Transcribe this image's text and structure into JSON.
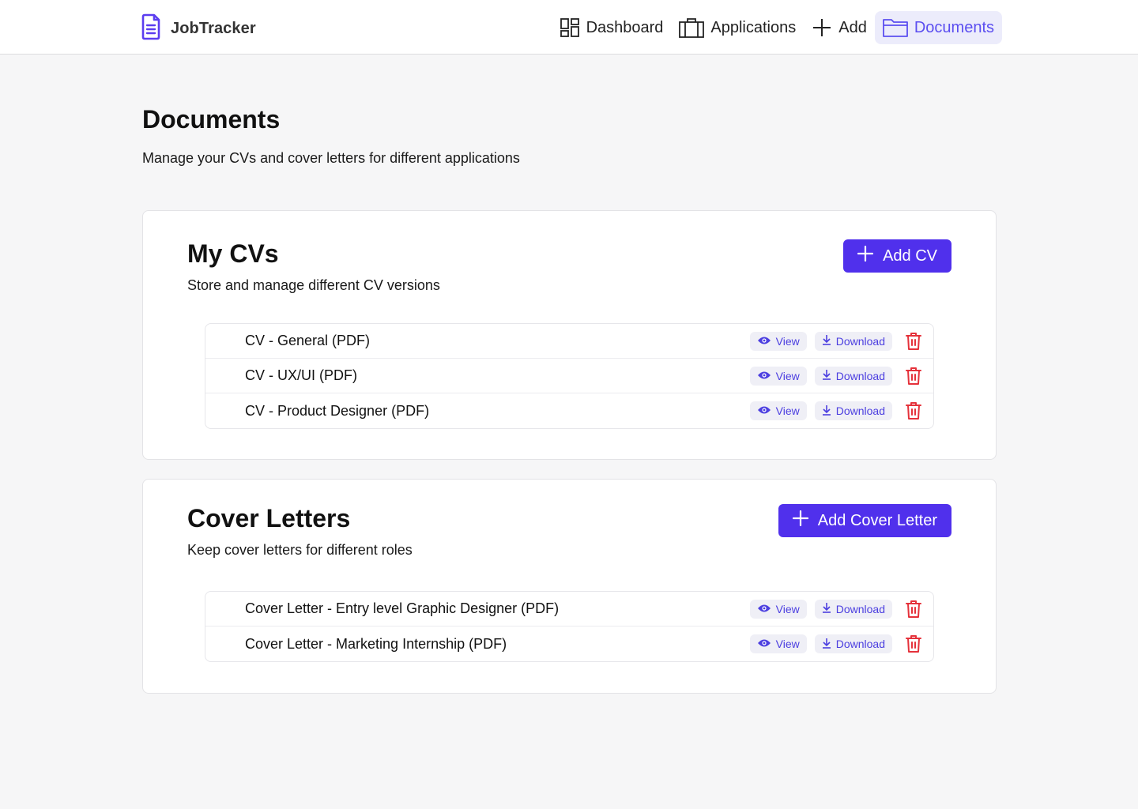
{
  "app": {
    "name": "JobTracker",
    "logo_icon": "document-icon",
    "accent": "#5030ec",
    "danger": "#e5323b"
  },
  "nav": {
    "items": [
      {
        "label": "Dashboard",
        "icon": "dashboard-icon",
        "active": false
      },
      {
        "label": "Applications",
        "icon": "briefcase-icon",
        "active": false
      },
      {
        "label": "Add",
        "icon": "plus-icon",
        "active": false
      },
      {
        "label": "Documents",
        "icon": "folder-icon",
        "active": true
      }
    ]
  },
  "page": {
    "title": "Documents",
    "subtitle": "Manage your CVs and cover letters for different applications"
  },
  "cvs": {
    "title": "My CVs",
    "subtitle": "Store and manage different CV versions",
    "add_label": "Add CV",
    "items": [
      {
        "name": "CV - General (PDF)"
      },
      {
        "name": "CV - UX/UI (PDF)"
      },
      {
        "name": "CV - Product Designer (PDF)"
      }
    ]
  },
  "cover_letters": {
    "title": "Cover Letters",
    "subtitle": "Keep cover letters for different roles",
    "add_label": "Add Cover Letter",
    "items": [
      {
        "name": "Cover Letter - Entry level Graphic Designer (PDF)"
      },
      {
        "name": "Cover Letter - Marketing Internship (PDF)"
      }
    ]
  },
  "row_actions": {
    "view_label": "View",
    "download_label": "Download"
  }
}
